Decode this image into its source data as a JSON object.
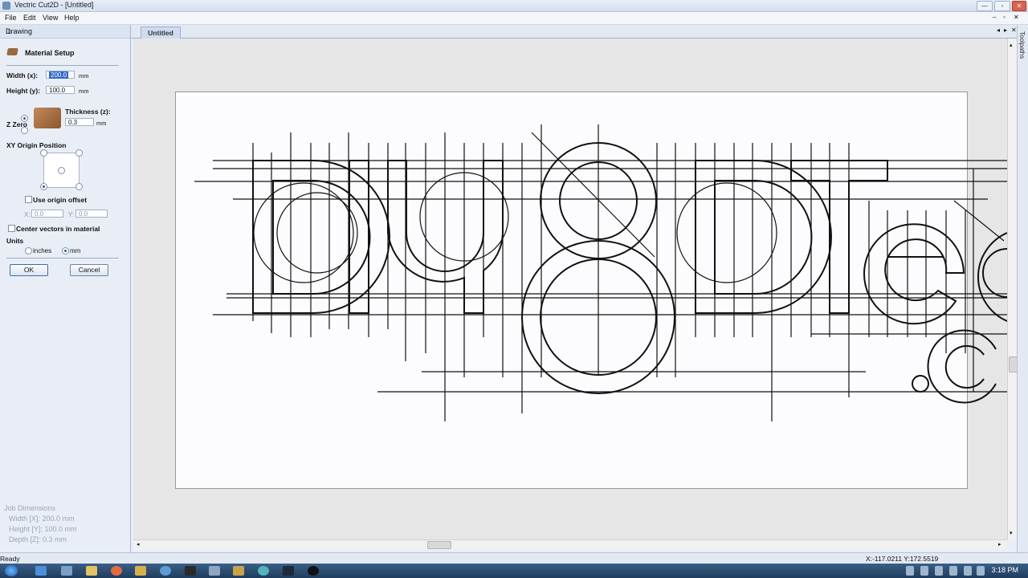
{
  "window": {
    "title": "Vectric Cut2D - [Untitled]"
  },
  "menu": {
    "file": "File",
    "edit": "Edit",
    "view": "View",
    "help": "Help"
  },
  "panel": {
    "header": "Drawing",
    "section_title": "Material Setup",
    "width_label": "Width (x):",
    "width_value": "200.0",
    "height_label": "Height (y):",
    "height_value": "100.0",
    "unit_mm": "mm",
    "thickness_label": "Thickness (z):",
    "thickness_value": "0.3",
    "zzero_label": "Z Zero",
    "xy_origin_label": "XY Origin Position",
    "use_origin_offset": "Use origin offset",
    "x_label": "X:",
    "x_value": "0.0",
    "y_label": "Y:",
    "y_value": "0.0",
    "center_vectors": "Center vectors in material",
    "units_label": "Units",
    "units_inches": "inches",
    "units_mm": "mm",
    "ok": "OK",
    "cancel": "Cancel"
  },
  "job_dimensions": {
    "title": "Job Dimensions",
    "width": "Width  [X]: 200.0 mm",
    "height": "Height [Y]: 100.0 mm",
    "depth": "Depth  [Z]: 0.3 mm"
  },
  "document": {
    "tab": "Untitled",
    "side_tab": "Toolpaths"
  },
  "status": {
    "left": "Ready",
    "coords": "X:-117.0211 Y:172.5519"
  },
  "taskbar": {
    "clock": "3:18 PM"
  },
  "colors": {
    "selection": "#3169c6",
    "panel_bg": "#e9eef6",
    "canvas_bg": "#e6e6e6"
  }
}
